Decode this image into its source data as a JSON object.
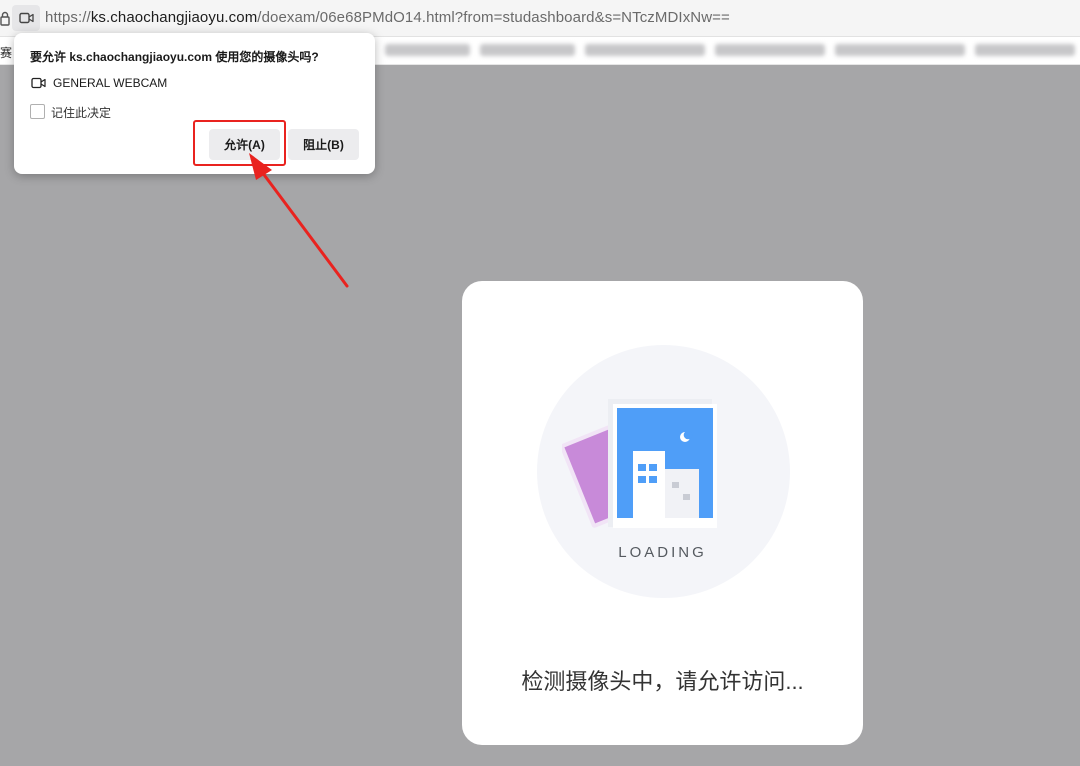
{
  "urlbar": {
    "url_prefix": "https://",
    "url_domain": "ks.chaochangjiaoyu.com",
    "url_path": "/doexam/06e68PMdO14.html?from=studashboard&s=NTczMDIxNw=="
  },
  "bookmarks": {
    "first_label": "赛"
  },
  "permission_popup": {
    "title": "要允许 ks.chaochangjiaoyu.com 使用您的摄像头吗?",
    "device_name": "GENERAL WEBCAM",
    "remember_label": "记住此决定",
    "remember_checked": false,
    "allow_label": "允许(A)",
    "block_label": "阻止(B)"
  },
  "annotation": {
    "color": "#e9231f"
  },
  "card": {
    "loading_label": "LOADING",
    "status_message": "检测摄像头中，请允许访问..."
  },
  "colors": {
    "page_background": "#a6a6a8",
    "card_background": "#ffffff",
    "illustration_blue": "#4f9ef8",
    "illustration_purple": "#c88ad9"
  }
}
